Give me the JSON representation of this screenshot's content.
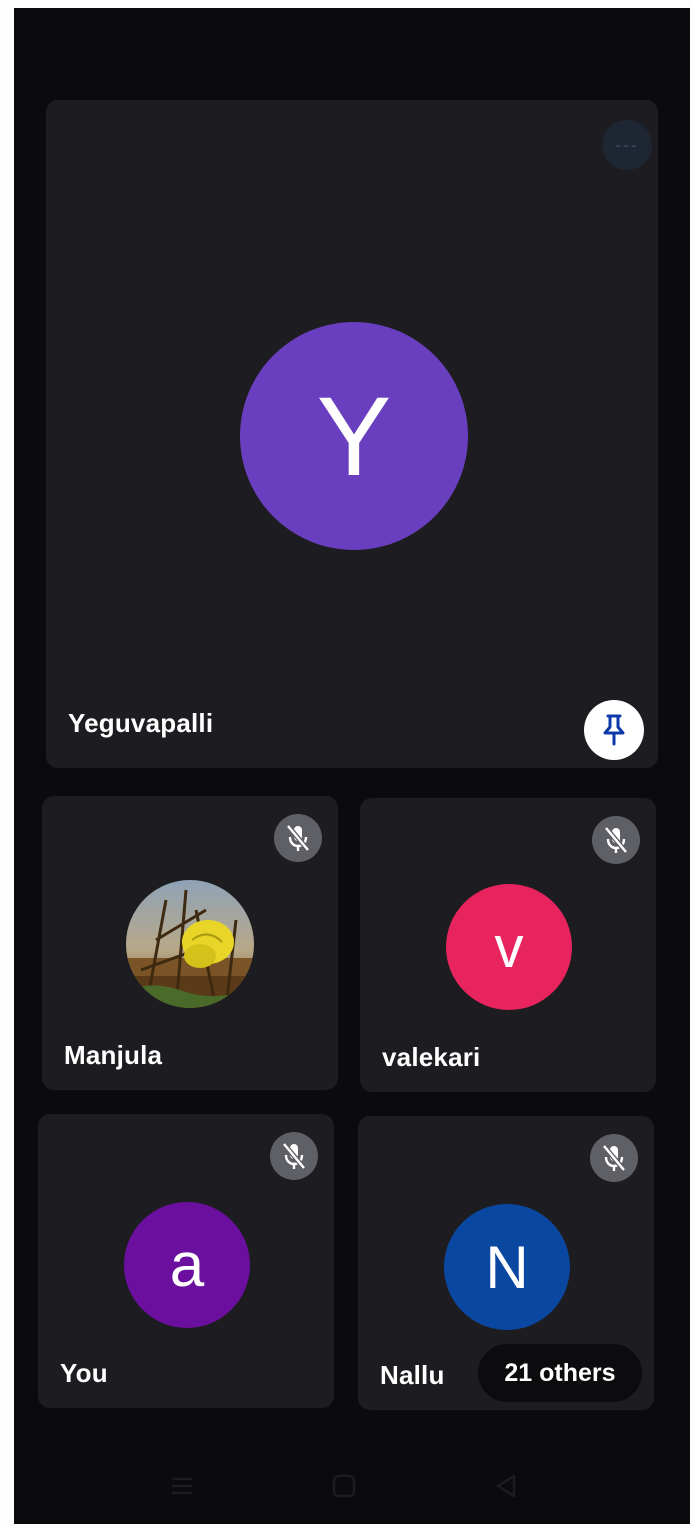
{
  "main_tile": {
    "name": "Yeguvapalli",
    "initial": "Y",
    "avatar_color": "#6a3fbf",
    "more_label": "---"
  },
  "tiles": [
    {
      "name": "Manjula",
      "avatar_type": "photo"
    },
    {
      "name": "valekari",
      "initial": "v",
      "avatar_color": "#e8245f"
    },
    {
      "name": "You",
      "initial": "a",
      "avatar_color": "#6a0f9e"
    },
    {
      "name": "Nallu",
      "initial": "N",
      "avatar_color": "#0a47a0"
    }
  ],
  "others_chip": "21 others",
  "icons": {
    "pin": "pin-icon",
    "mute": "mic-off-icon",
    "more": "more-icon",
    "nav": [
      "menu-icon",
      "home-icon",
      "back-icon"
    ]
  },
  "colors": {
    "background": "#0b0b0e",
    "tile": "#1d1d21",
    "pin_accent": "#0b3aa8"
  }
}
